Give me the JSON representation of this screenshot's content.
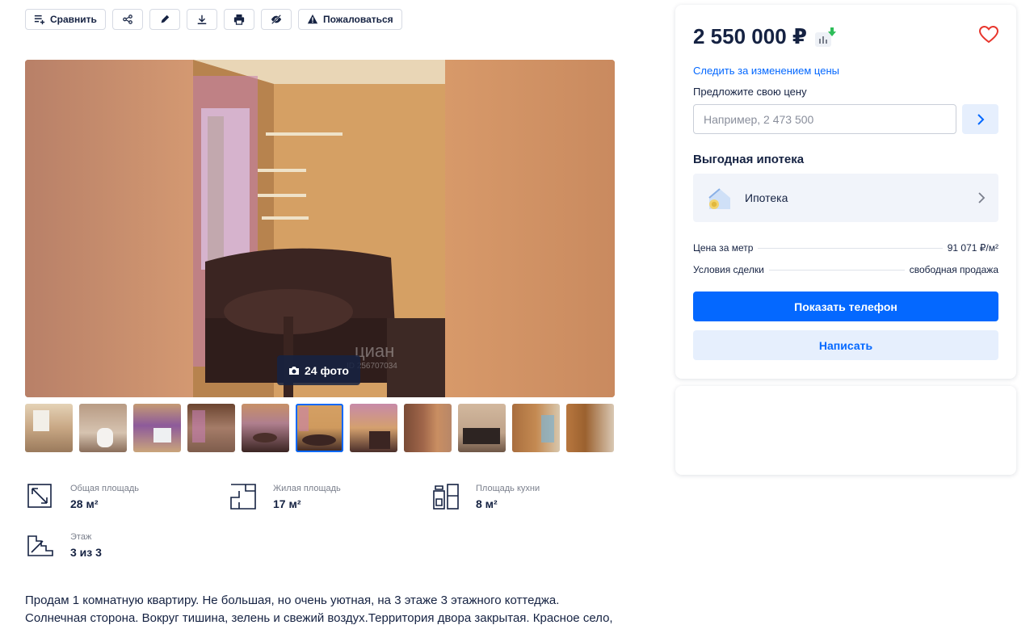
{
  "toolbar": {
    "compare_label": "Сравнить",
    "complain_label": "Пожаловаться"
  },
  "gallery": {
    "photo_count": "24 фото",
    "watermark": "циан",
    "watermark_id": "ID 256707034"
  },
  "features": [
    {
      "label": "Общая площадь",
      "value": "28 м²"
    },
    {
      "label": "Жилая площадь",
      "value": "17 м²"
    },
    {
      "label": "Площадь кухни",
      "value": "8 м²"
    },
    {
      "label": "Этаж",
      "value": "3 из 3"
    }
  ],
  "description": "Продам 1 комнатную квартиру. Не большая, но очень уютная, на 3 этаже 3 этажного коттеджа. Солнечная сторона. Вокруг тишина, зелень и свежий воздух.Территория двора закрытая. Красное село,",
  "sidebar": {
    "price": "2 550 000 ₽",
    "track_price_link": "Следить за изменением цены",
    "offer_label": "Предложите свою цену",
    "offer_placeholder": "Например, 2 473 500",
    "mortgage_title": "Выгодная ипотека",
    "mortgage_label": "Ипотека",
    "price_per_meter_label": "Цена за метр",
    "price_per_meter_value": "91 071 ₽/м²",
    "deal_terms_label": "Условия сделки",
    "deal_terms_value": "свободная продажа",
    "show_phone": "Показать телефон",
    "write": "Написать"
  },
  "colors": {
    "accent": "#0468ff",
    "text": "#152242",
    "heart": "#e8352c",
    "price_down": "#2ebd59"
  }
}
